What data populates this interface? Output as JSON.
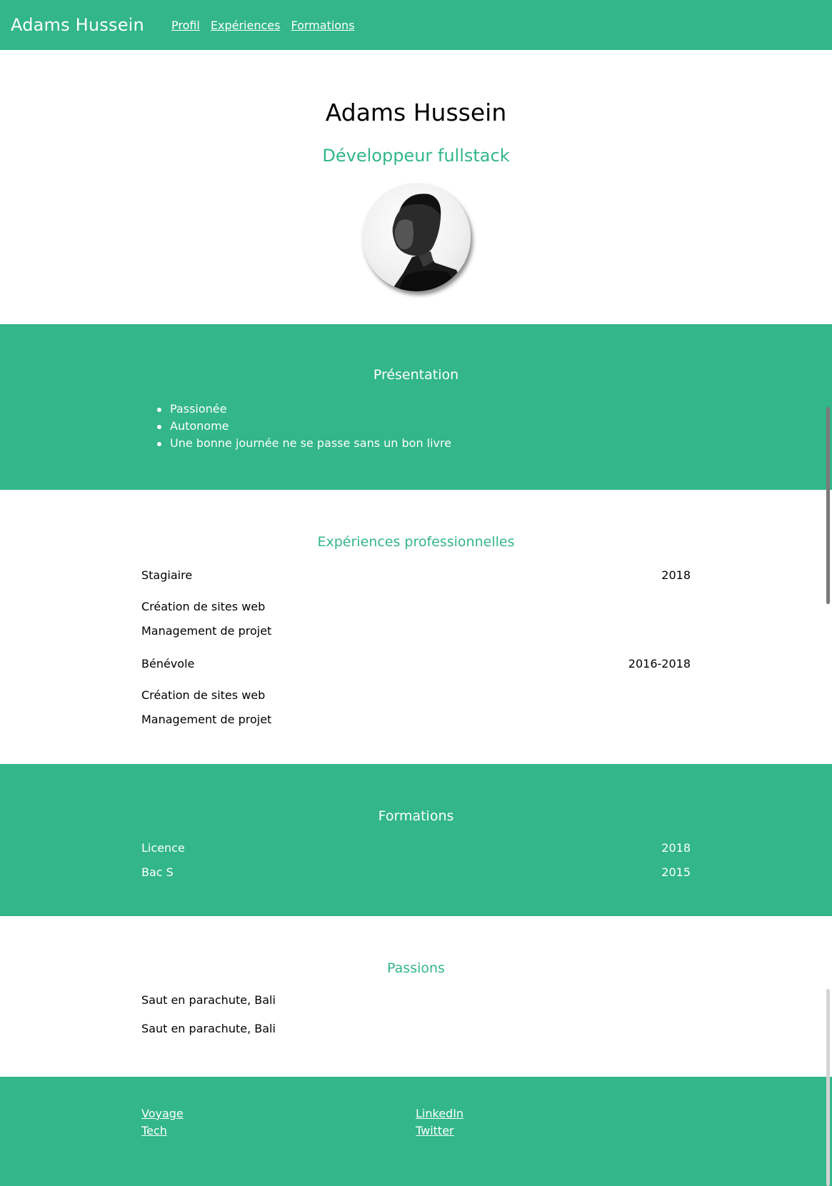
{
  "nav": {
    "brand": "Adams Hussein",
    "links": [
      "Profil",
      "Expériences",
      "Formations"
    ]
  },
  "hero": {
    "name": "Adams Hussein",
    "role": "Développeur fullstack"
  },
  "presentation": {
    "title": "Présentation",
    "items": [
      "Passionée",
      "Autonome",
      "Une bonne journée ne se passe sans un bon livre"
    ]
  },
  "experiences": {
    "title": "Expériences professionnelles",
    "jobs": [
      {
        "title": "Stagiaire",
        "date": "2018",
        "tasks": [
          "Création de sites web",
          "Management de projet"
        ]
      },
      {
        "title": "Bénévole",
        "date": "2016-2018",
        "tasks": [
          "Création de sites web",
          "Management de projet"
        ]
      }
    ]
  },
  "formations": {
    "title": "Formations",
    "items": [
      {
        "name": "Licence",
        "year": "2018"
      },
      {
        "name": "Bac S",
        "year": "2015"
      }
    ]
  },
  "passions": {
    "title": "Passions",
    "items": [
      "Saut en parachute, Bali",
      "Saut en parachute, Bali"
    ]
  },
  "footer": {
    "left_links": [
      "Voyage",
      "Tech"
    ],
    "right_links": [
      "LinkedIn",
      "Twitter"
    ]
  },
  "colors": {
    "accent": "#32b68a",
    "text": "#000000",
    "background": "#ffffff"
  }
}
